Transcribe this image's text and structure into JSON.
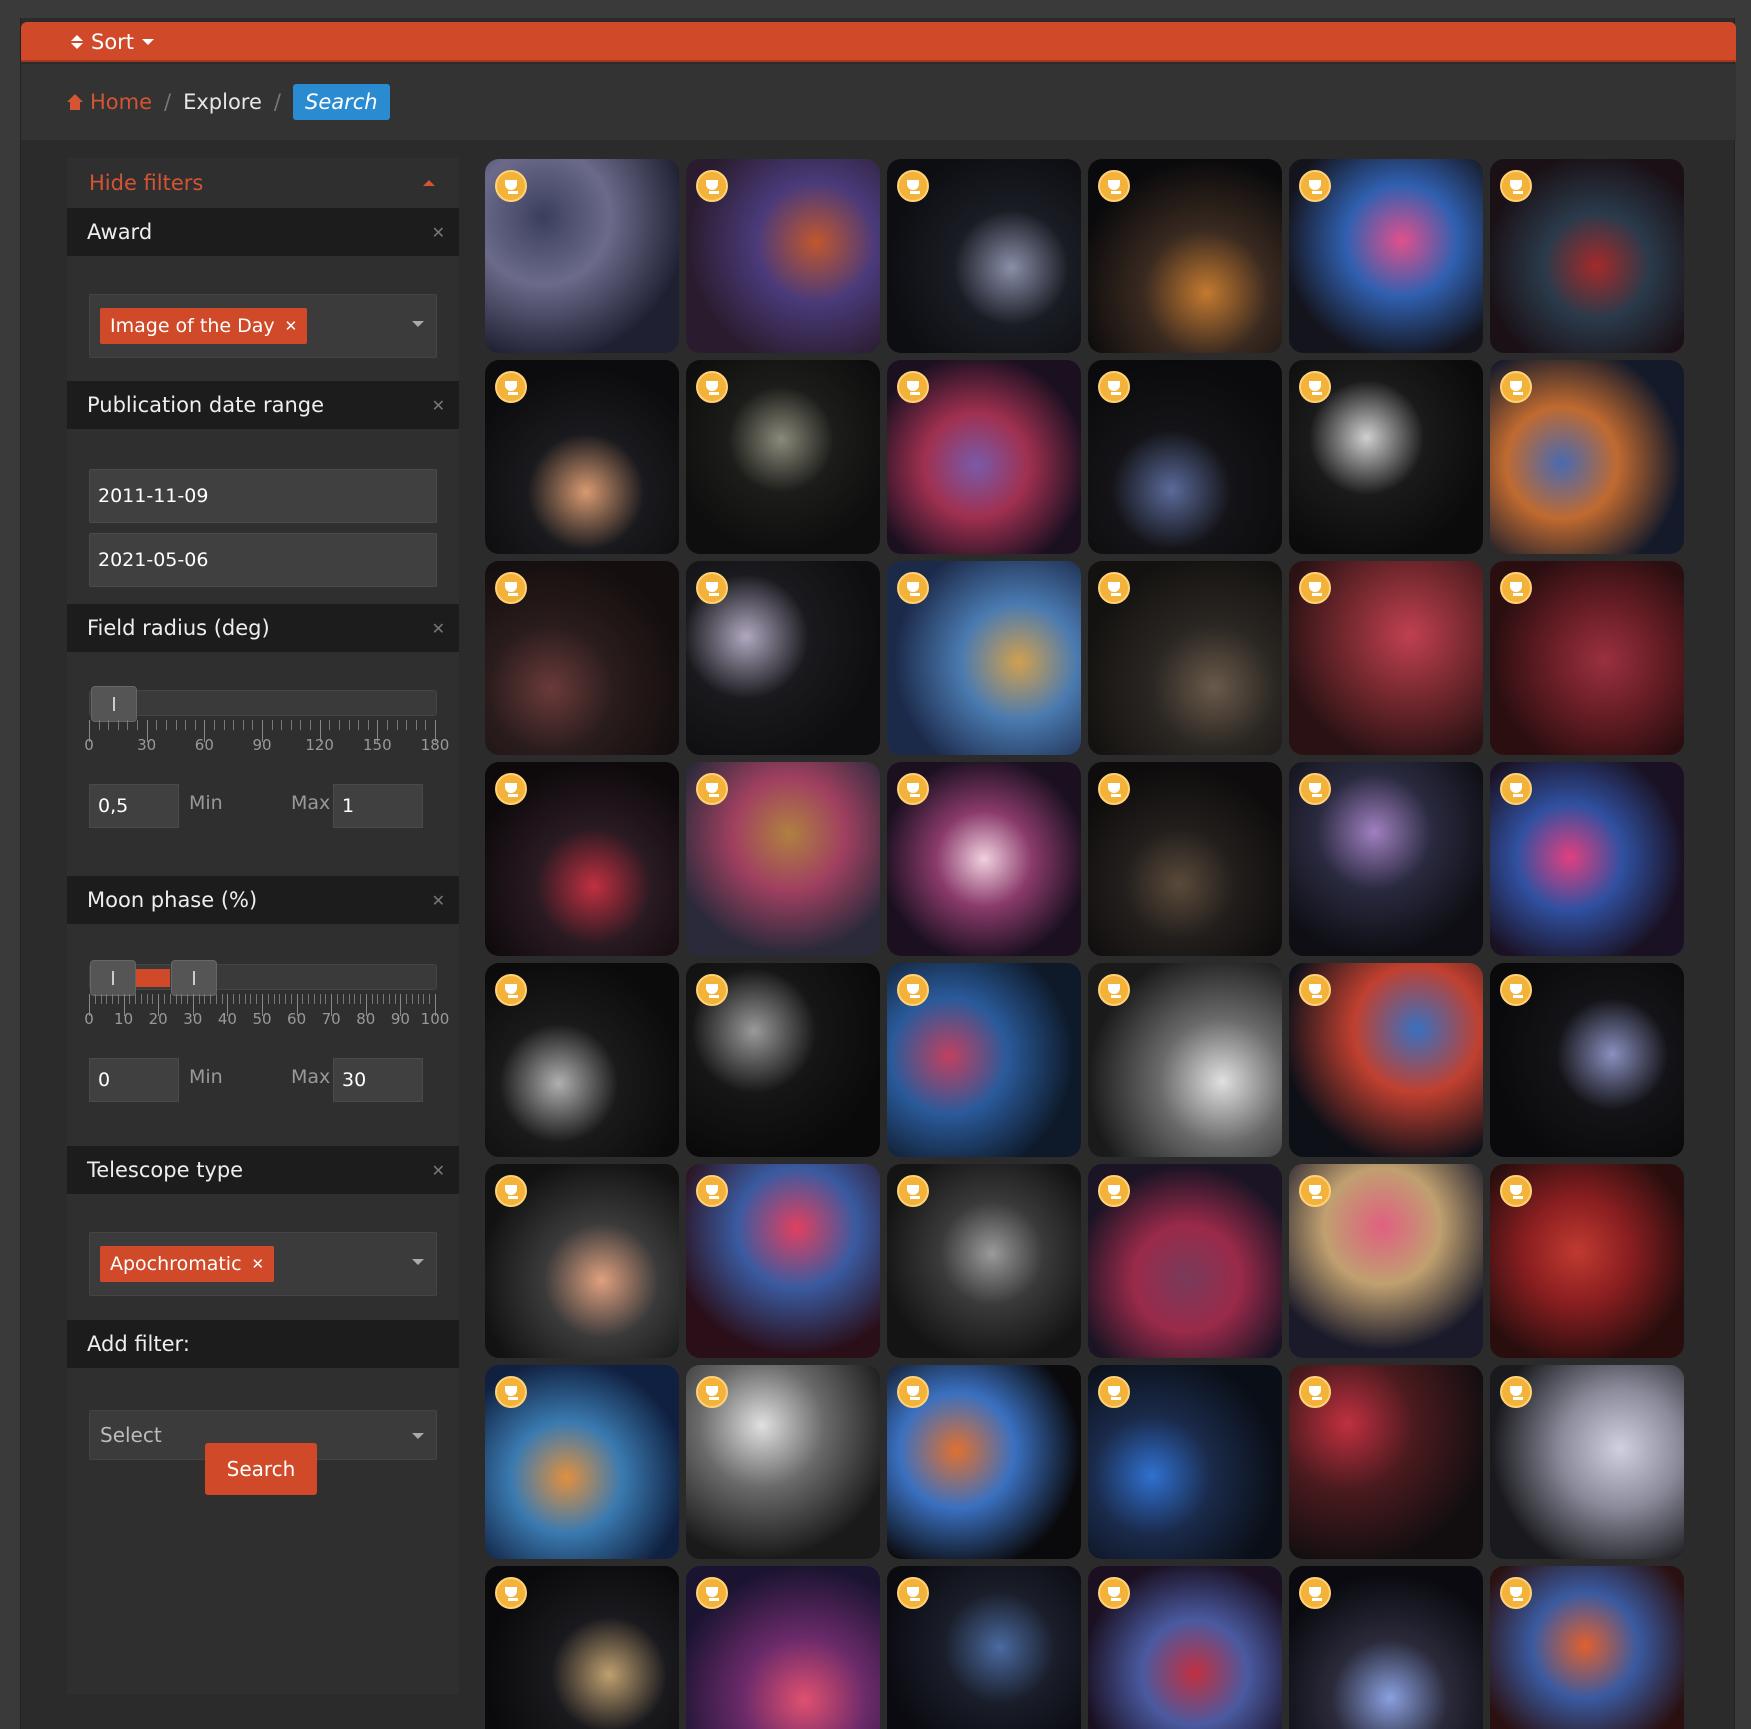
{
  "sortbar": {
    "label": "Sort"
  },
  "breadcrumb": {
    "home": "Home",
    "explore": "Explore",
    "current": "Search",
    "sep": "/"
  },
  "sidebar": {
    "hide_filters": "Hide filters",
    "award": {
      "title": "Award",
      "tag": "Image of the Day"
    },
    "pubdate": {
      "title": "Publication date range",
      "start": "2011-11-09",
      "end": "2021-05-06"
    },
    "field_radius": {
      "title": "Field radius (deg)",
      "ticks": [
        "0",
        "30",
        "60",
        "90",
        "120",
        "150",
        "180"
      ],
      "range_max": 180,
      "min_value": "0,5",
      "max_value": "1",
      "min_label": "Min",
      "max_label": "Max",
      "handle_low": 0.5,
      "handle_high": 1
    },
    "moon_phase": {
      "title": "Moon phase (%)",
      "ticks": [
        "0",
        "10",
        "20",
        "30",
        "40",
        "50",
        "60",
        "70",
        "80",
        "90",
        "100"
      ],
      "range_max": 100,
      "min_value": "0",
      "max_value": "30",
      "min_label": "Min",
      "max_label": "Max",
      "handle_low": 0,
      "handle_high": 30
    },
    "telescope": {
      "title": "Telescope type",
      "tag": "Apochromatic"
    },
    "add_filter": {
      "title": "Add filter:",
      "placeholder": "Select"
    },
    "search_button": "Search"
  },
  "gallery": {
    "award_icon": "trophy-icon",
    "rows": 8,
    "cols": 6,
    "thumbs": [
      {
        "c1": "#3a3f5c",
        "c2": "#6b6a8a",
        "c3": "#1f2133"
      },
      {
        "c1": "#c0572e",
        "c2": "#4a3a7a",
        "c3": "#2a1c2e"
      },
      {
        "c1": "#8a8fa8",
        "c2": "#1a1c24",
        "c3": "#0d0e12"
      },
      {
        "c1": "#c47a30",
        "c2": "#3a2a20",
        "c3": "#0a0a0c"
      },
      {
        "c1": "#e0508c",
        "c2": "#3060b0",
        "c3": "#14141c"
      },
      {
        "c1": "#a32a2a",
        "c2": "#2a3a4a",
        "c3": "#1a1016"
      },
      {
        "c1": "#d89a70",
        "c2": "#1a1a1e",
        "c3": "#0c0c0e"
      },
      {
        "c1": "#8a8a7a",
        "c2": "#1c1c1a",
        "c3": "#0e0e0e"
      },
      {
        "c1": "#7a5aa8",
        "c2": "#a03050",
        "c3": "#1a1020"
      },
      {
        "c1": "#5a6a9a",
        "c2": "#141418",
        "c3": "#0b0b0d"
      },
      {
        "c1": "#d0d0d0",
        "c2": "#1a1a1a",
        "c3": "#0b0b0b"
      },
      {
        "c1": "#4a6ab0",
        "c2": "#c06a30",
        "c3": "#141a2a"
      },
      {
        "c1": "#6a3a3a",
        "c2": "#2a1c1c",
        "c3": "#140e0e"
      },
      {
        "c1": "#b0a8c0",
        "c2": "#1a1a1e",
        "c3": "#0e0e10"
      },
      {
        "c1": "#d0a050",
        "c2": "#4a7ab0",
        "c3": "#1c2a4a"
      },
      {
        "c1": "#6a5a4a",
        "c2": "#2a2622",
        "c3": "#141210"
      },
      {
        "c1": "#c04050",
        "c2": "#7a2a30",
        "c3": "#2a1214"
      },
      {
        "c1": "#9a3040",
        "c2": "#6a1e26",
        "c3": "#2a0e10"
      },
      {
        "c1": "#c03040",
        "c2": "#2a1a22",
        "c3": "#0e0a0c"
      },
      {
        "c1": "#b08040",
        "c2": "#a04060",
        "c3": "#2a2a3a"
      },
      {
        "c1": "#f0d0e0",
        "c2": "#8a3a6a",
        "c3": "#1a1020"
      },
      {
        "c1": "#5a4a3a",
        "c2": "#221e1c",
        "c3": "#0e0c0c"
      },
      {
        "c1": "#a080c0",
        "c2": "#2a2a40",
        "c3": "#0e0e14"
      },
      {
        "c1": "#e04080",
        "c2": "#3050a0",
        "c3": "#1a1224"
      },
      {
        "c1": "#b0b0b0",
        "c2": "#1a1a1a",
        "c3": "#0b0b0b"
      },
      {
        "c1": "#9a9a9a",
        "c2": "#161616",
        "c3": "#0a0a0a"
      },
      {
        "c1": "#c04060",
        "c2": "#2a5a9a",
        "c3": "#0e1a2a"
      },
      {
        "c1": "#e0e0e0",
        "c2": "#6a6a6a",
        "c3": "#1a1a1a"
      },
      {
        "c1": "#3a70c0",
        "c2": "#c04030",
        "c3": "#0e1018"
      },
      {
        "c1": "#8a90c0",
        "c2": "#141418",
        "c3": "#0a0a0c"
      },
      {
        "c1": "#e0a080",
        "c2": "#3a3a3a",
        "c3": "#121212"
      },
      {
        "c1": "#e04060",
        "c2": "#3a5aa0",
        "c3": "#2a0e18"
      },
      {
        "c1": "#9a9a9a",
        "c2": "#3a3a3a",
        "c3": "#141414"
      },
      {
        "c1": "#7a3a5a",
        "c2": "#9a2a4a",
        "c3": "#1a1424"
      },
      {
        "c1": "#e06080",
        "c2": "#c0a070",
        "c3": "#1a1a2a"
      },
      {
        "c1": "#c03a30",
        "c2": "#8a1e20",
        "c3": "#2a0e0e"
      },
      {
        "c1": "#e09040",
        "c2": "#3a7ab0",
        "c3": "#102040"
      },
      {
        "c1": "#e0e0e0",
        "c2": "#6a6a6a",
        "c3": "#1a1a1a"
      },
      {
        "c1": "#e07030",
        "c2": "#3a70c0",
        "c3": "#0a0a0c"
      },
      {
        "c1": "#3070d0",
        "c2": "#1a2a4a",
        "c3": "#0a0e16"
      },
      {
        "c1": "#c03040",
        "c2": "#4a1a1e",
        "c3": "#120e10"
      },
      {
        "c1": "#d0d0e0",
        "c2": "#8a8a9a",
        "c3": "#1a1a1e"
      },
      {
        "c1": "#c0a070",
        "c2": "#1a1a1e",
        "c3": "#0a0a0c"
      },
      {
        "c1": "#e05070",
        "c2": "#6a2a6a",
        "c3": "#1a1430"
      },
      {
        "c1": "#4a6aa0",
        "c2": "#1a1e2a",
        "c3": "#0a0a10"
      },
      {
        "c1": "#c03040",
        "c2": "#4a5aa0",
        "c3": "#1a1022"
      },
      {
        "c1": "#8aa0e0",
        "c2": "#2a2a3a",
        "c3": "#0a0a10"
      },
      {
        "c1": "#e06030",
        "c2": "#3a5aa0",
        "c3": "#2a1010"
      }
    ]
  }
}
